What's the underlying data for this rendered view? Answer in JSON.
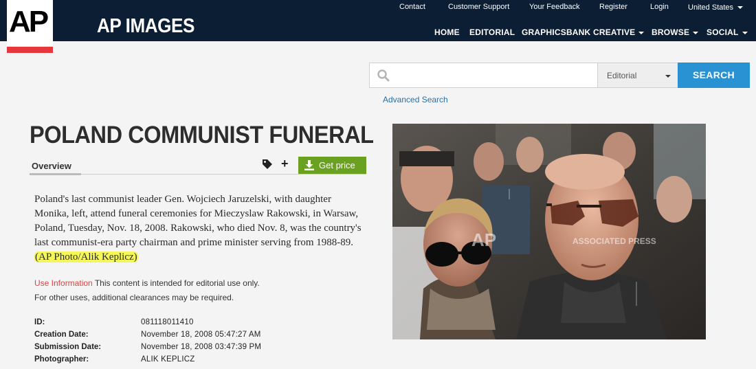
{
  "header": {
    "logo_text": "AP",
    "brand": "AP IMAGES",
    "utility_nav": [
      "Contact",
      "Customer Support",
      "Your Feedback",
      "Register",
      "Login"
    ],
    "region": "United States",
    "main_nav": [
      {
        "label": "HOME",
        "dropdown": false
      },
      {
        "label": "EDITORIAL",
        "dropdown": false
      },
      {
        "label": "GRAPHICSBANK",
        "dropdown": false
      },
      {
        "label": "CREATIVE",
        "dropdown": true
      },
      {
        "label": "BROWSE",
        "dropdown": true
      },
      {
        "label": "SOCIAL",
        "dropdown": true
      }
    ]
  },
  "search": {
    "placeholder": "",
    "value": "",
    "scope": "Editorial",
    "button": "SEARCH",
    "advanced": "Advanced Search"
  },
  "page": {
    "title": "POLAND COMMUNIST FUNERAL",
    "tab": "Overview",
    "get_price": "Get price",
    "description": "Poland's last communist leader Gen. Wojciech Jaruzelski, with daughter Monika, left, attend funeral ceremonies for Mieczyslaw Rakowski, in Warsaw, Poland, Tuesday, Nov. 18, 2008. Rakowski, who died Nov. 8, was the country's last communist-era party chairman and prime minister serving from 1988-89.",
    "credit": "(AP Photo/Alik Keplicz)",
    "use_info_label": "Use Information",
    "use_info_text": "This content is intended for editorial use only.",
    "use_info_text2": "For other uses, additional clearances may be required."
  },
  "metadata": [
    {
      "key": "ID:",
      "value": "081118011410"
    },
    {
      "key": "Creation Date:",
      "value": "November 18, 2008 05:47:27 AM"
    },
    {
      "key": "Submission Date:",
      "value": "November 18, 2008 03:47:39 PM"
    },
    {
      "key": "Photographer:",
      "value": "ALIK KEPLICZ"
    }
  ],
  "photo": {
    "watermark_logo": "AP",
    "watermark_text": "ASSOCIATED PRESS"
  },
  "colors": {
    "header_bg": "#0b1e33",
    "accent_red": "#e8363d",
    "search_blue": "#2992d3",
    "price_green": "#6aa121",
    "highlight_yellow": "#f4f65a"
  }
}
